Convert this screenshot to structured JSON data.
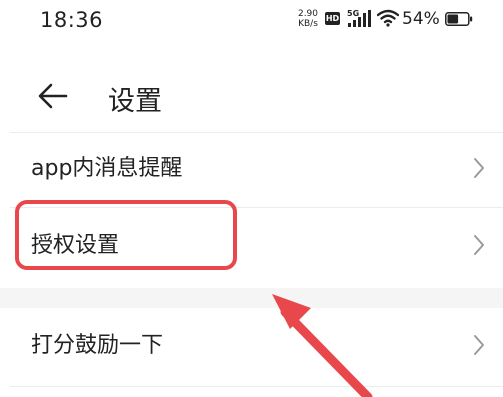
{
  "status_bar": {
    "time": "18:36",
    "net_speed_value": "2.90",
    "net_speed_unit": "KB/s",
    "hd_label": "HD",
    "network_type": "5G",
    "battery_percent": "54%",
    "battery_level": 0.54
  },
  "header": {
    "back_icon": "arrow-left-icon",
    "title": "设置"
  },
  "settings": [
    {
      "label": "app内消息提醒",
      "icon": "chevron-right-icon"
    },
    {
      "label": "授权设置",
      "icon": "chevron-right-icon"
    },
    {
      "label": "打分鼓励一下",
      "icon": "chevron-right-icon"
    }
  ],
  "annotation": {
    "highlight_color": "#e8484c",
    "highlighted_item": "授权设置"
  }
}
